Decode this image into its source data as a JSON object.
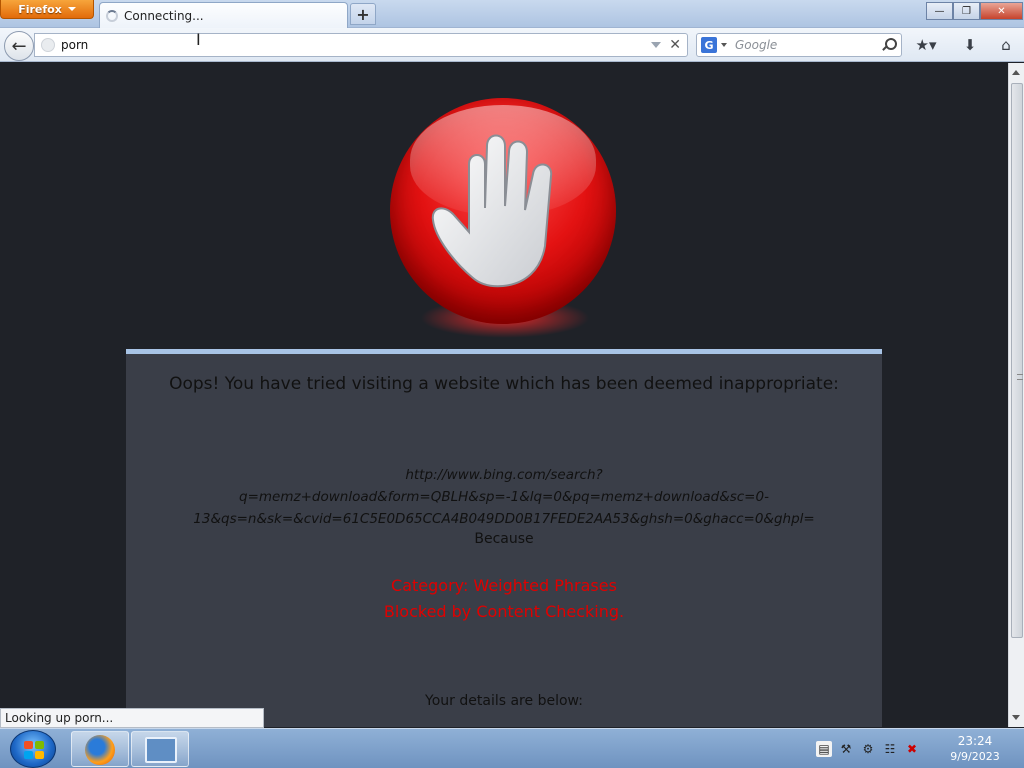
{
  "browser": {
    "menu_button": "Firefox",
    "tab_title": "Connecting...",
    "new_tab": "+",
    "window_controls": {
      "minimize": "—",
      "maximize": "❐",
      "close": "✕"
    }
  },
  "navbar": {
    "url_value": "porn",
    "search_engine": "G",
    "search_placeholder": "Google"
  },
  "page": {
    "heading": "Oops! You have tried visiting a website which has been deemed inappropriate:",
    "blocked_url": "http://www.bing.com/search?q=memz+download&form=QBLH&sp=-1&lq=0&pq=memz+download&sc=0-13&qs=n&sk=&cvid=61C5E0D65CCA4B049DD0B17FEDE2AA53&ghsh=0&ghacc=0&ghpl=",
    "because": "Because",
    "category": "Category: Weighted Phrases",
    "blocked_by": "Blocked by Content Checking.",
    "details": "Your details are below:"
  },
  "status": {
    "text": "Looking up porn..."
  },
  "taskbar": {
    "clock_time": "23:24",
    "clock_date": "9/9/2023"
  },
  "colors": {
    "page_bg": "#1f2228",
    "panel_bg": "#3a3e48",
    "panel_border": "#a8c4e6",
    "alert_red": "#e00000",
    "firefox_orange": "#e26b0a"
  }
}
